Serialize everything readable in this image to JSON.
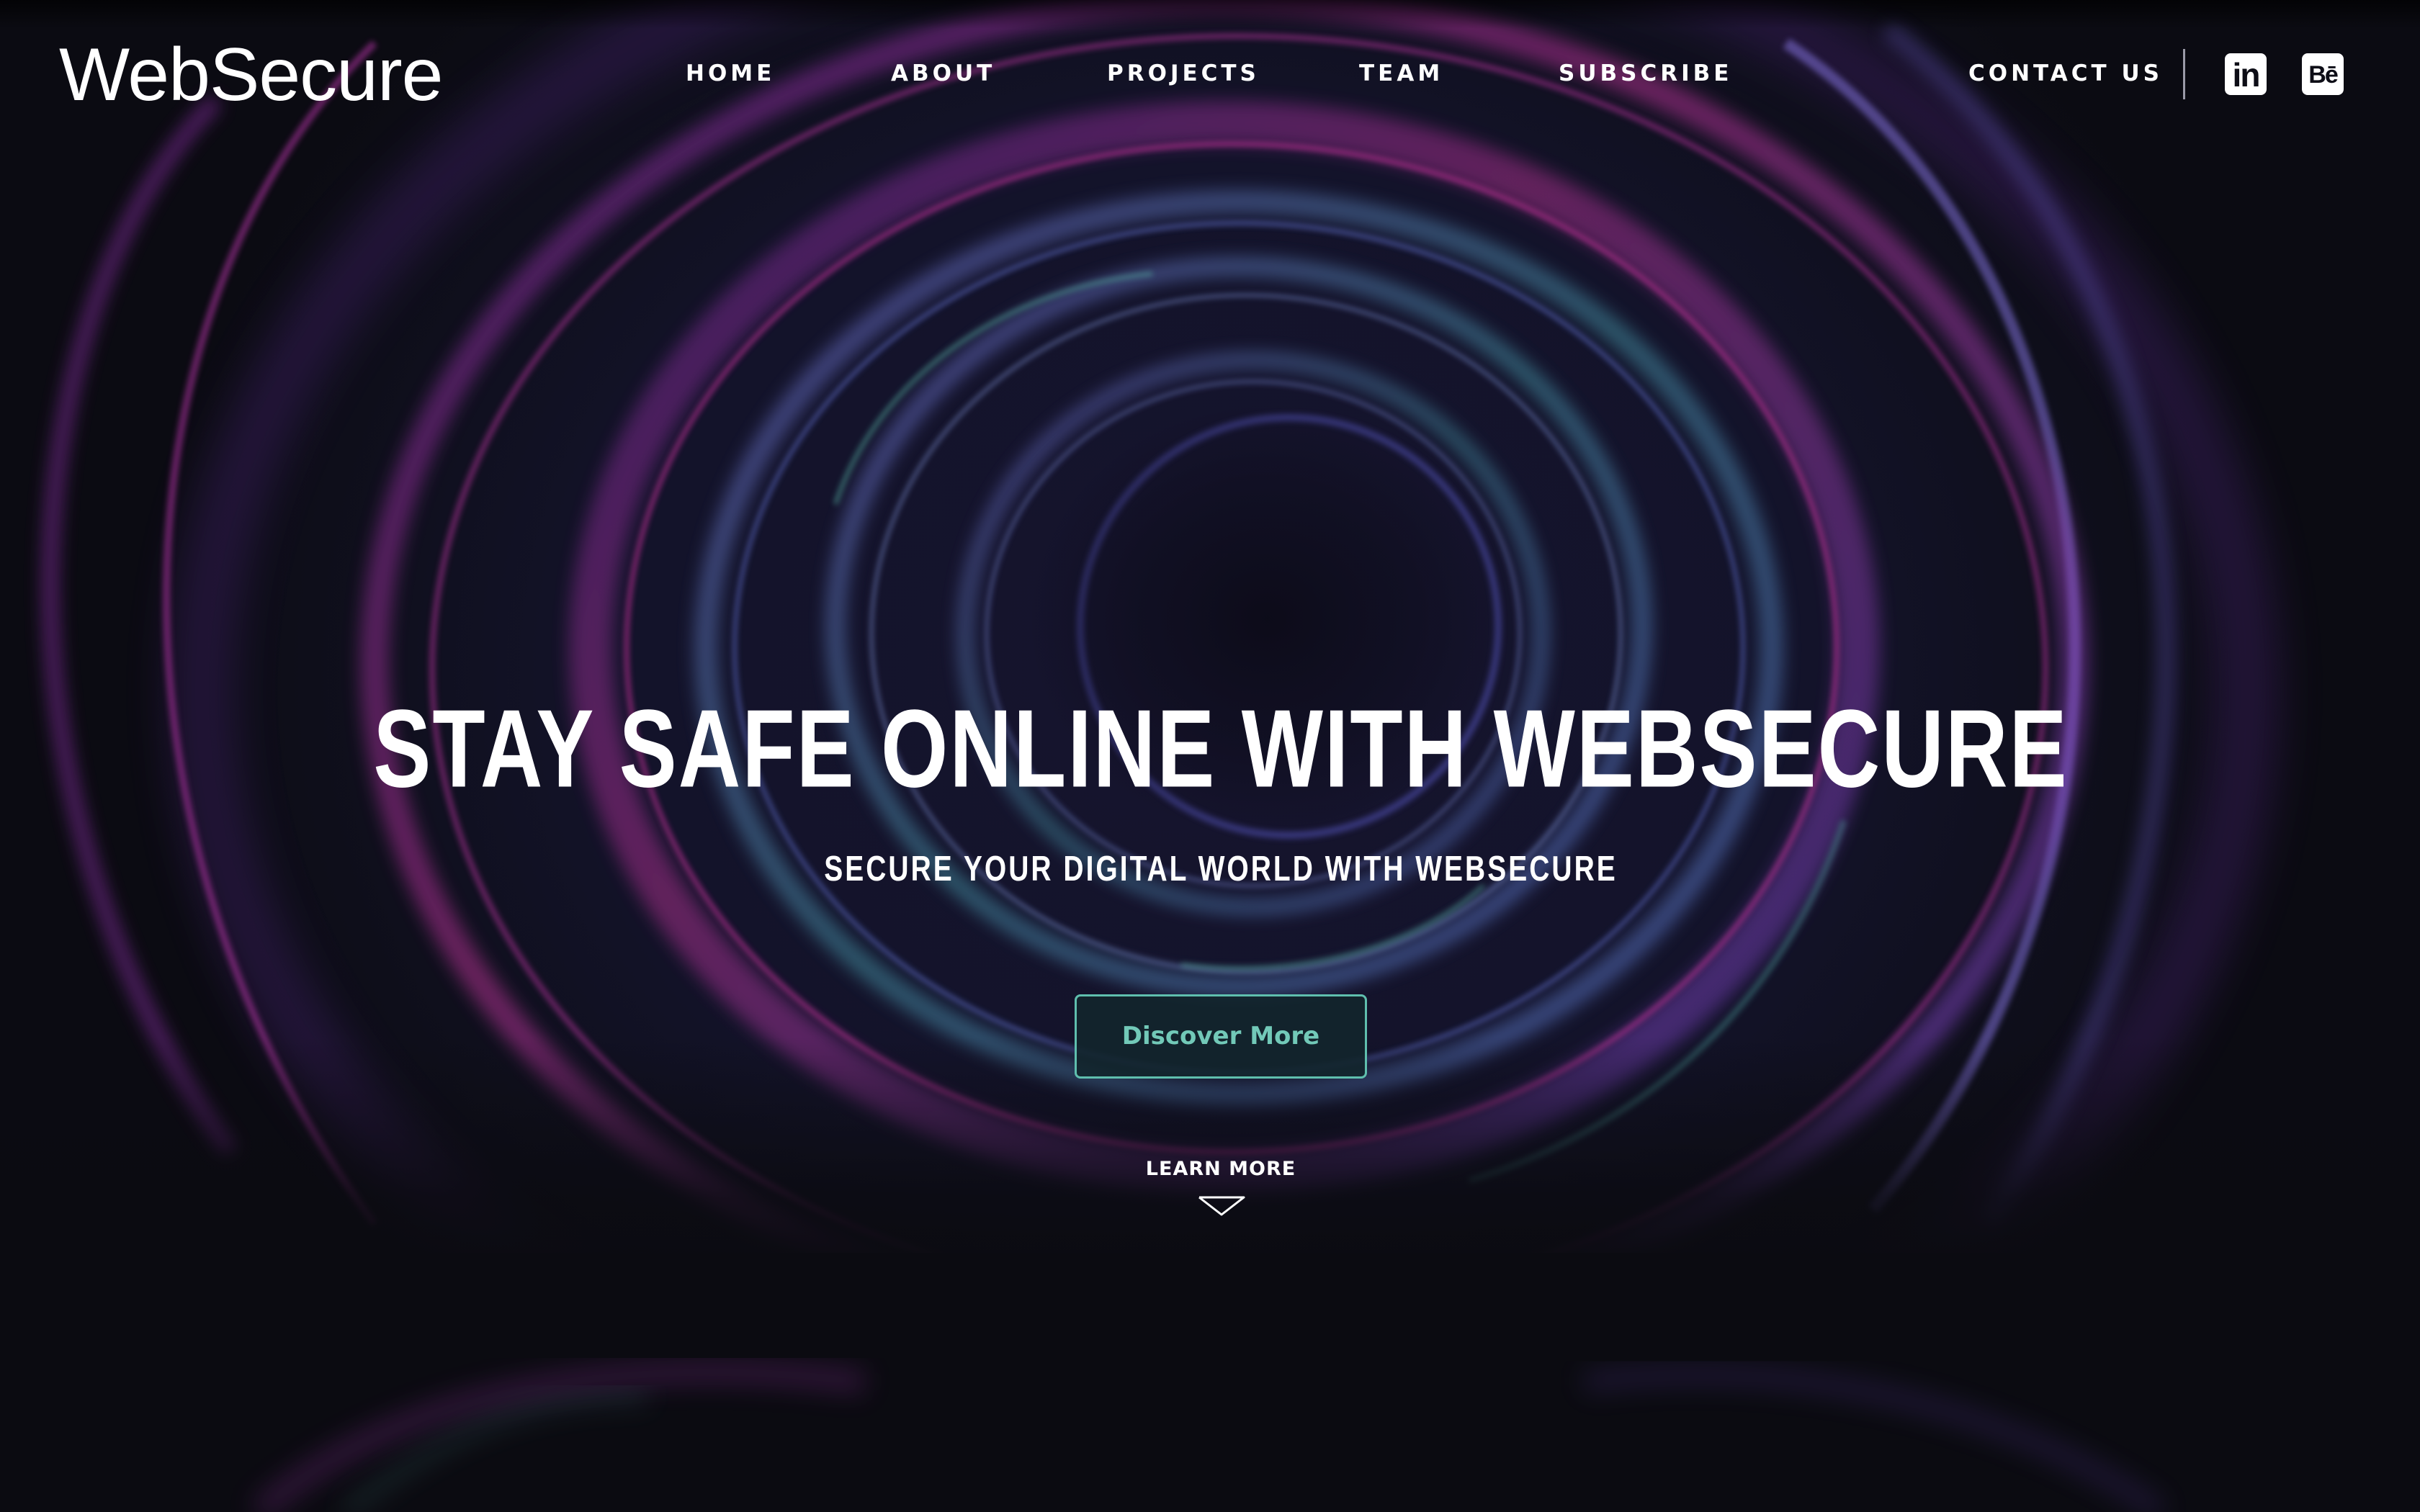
{
  "brand": {
    "logo_text": "WebSecure"
  },
  "nav": {
    "items": [
      {
        "label": "HOME"
      },
      {
        "label": "ABOUT"
      },
      {
        "label": "PROJECTS"
      },
      {
        "label": "TEAM"
      },
      {
        "label": "SUBSCRIBE"
      }
    ],
    "contact_label": "CONTACT US",
    "social": [
      {
        "icon": "linkedin-icon",
        "glyph": "in"
      },
      {
        "icon": "behance-icon",
        "glyph": "Bē"
      }
    ]
  },
  "hero": {
    "title": "STAY SAFE ONLINE WITH WEBSECURE",
    "subtitle": "SECURE YOUR DIGITAL WORLD WITH WEBSECURE",
    "cta_label": "Discover More",
    "learn_more_label": "LEARN MORE",
    "learn_more_icon": "chevron-down-icon"
  },
  "colors": {
    "background": "#0b0b11",
    "accent_teal": "#5fbfae",
    "ring_magenta": "#b0309a",
    "ring_blue": "#5a6ad0",
    "ring_teal": "#4fa8a0"
  }
}
